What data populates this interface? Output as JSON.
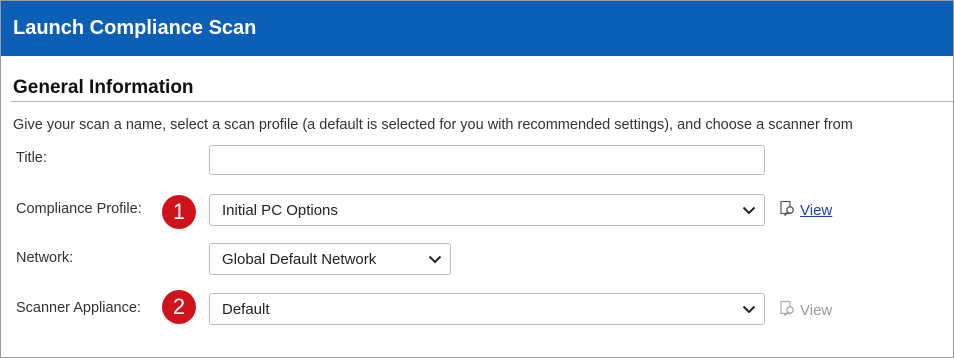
{
  "header": {
    "title": "Launch Compliance Scan"
  },
  "section": {
    "title": "General Information",
    "description": "Give your scan a name, select a scan profile (a default is selected for you with recommended settings), and choose a scanner from"
  },
  "form": {
    "title_label": "Title:",
    "title_value": "",
    "profile_label": "Compliance Profile:",
    "profile_value": "Initial PC Options",
    "profile_view": "View",
    "network_label": "Network:",
    "network_value": "Global Default Network",
    "scanner_label": "Scanner Appliance:",
    "scanner_value": "Default",
    "scanner_view": "View"
  },
  "badges": {
    "one": "1",
    "two": "2"
  },
  "colors": {
    "header_bg": "#0b5fb4",
    "badge": "#d0121b",
    "link": "#1a3fbf"
  }
}
